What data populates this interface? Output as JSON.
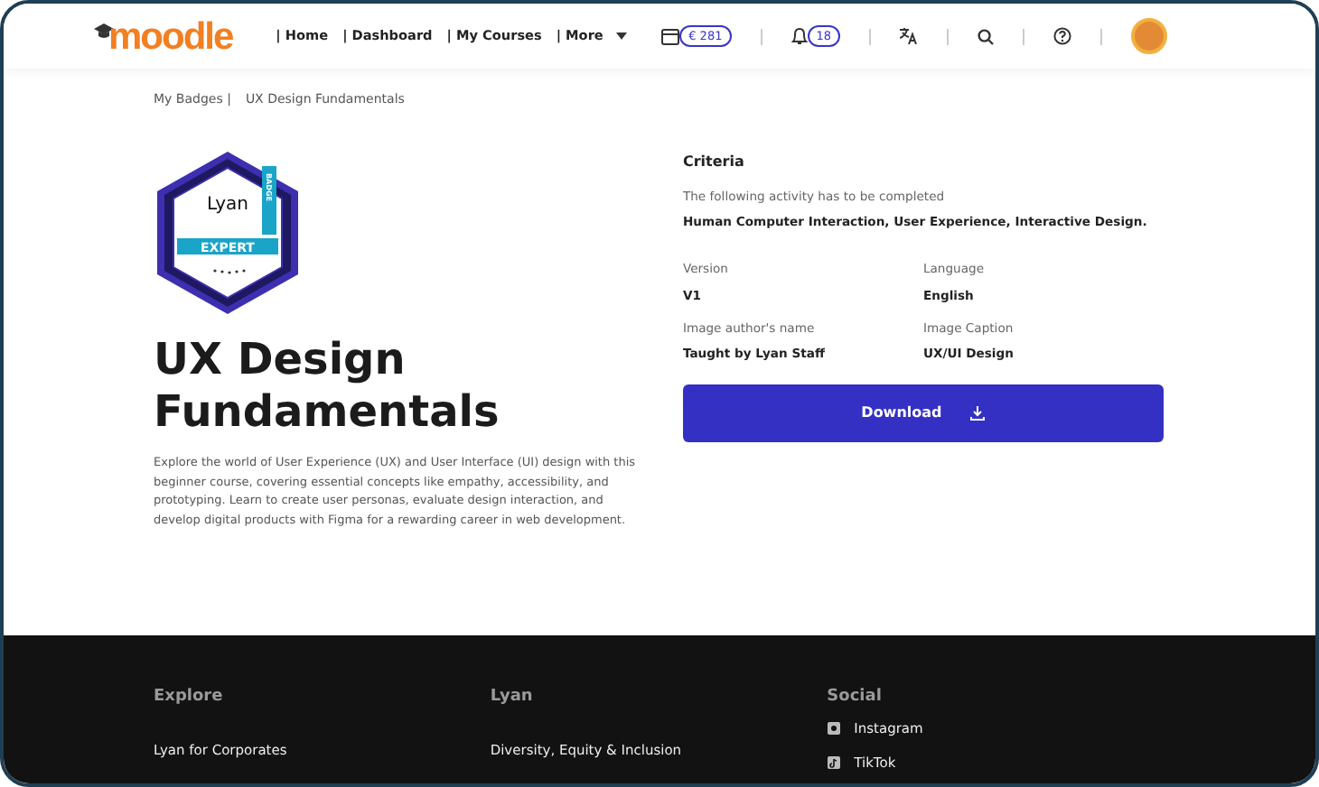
{
  "navbar": {
    "logo": "moodle",
    "links": [
      {
        "label": "| Home"
      },
      {
        "label": "| Dashboard"
      },
      {
        "label": "| My Courses"
      },
      {
        "label": "| More",
        "dropdown": true
      }
    ],
    "wallet": "€ 281",
    "notifications": "18"
  },
  "breadcrumb": [
    "My Badges |",
    "UX Design Fundamentals"
  ],
  "badge": {
    "brand": "Lyan",
    "ribbon": "BADGE",
    "level": "EXPERT"
  },
  "title": "UX Design Fundamentals",
  "description": "Explore the world of User Experience (UX) and User Interface (UI) design with this beginner course, covering essential concepts like empathy, accessibility, and prototyping. Learn to create user personas, evaluate design interaction, and develop digital products with Figma for a rewarding career in web development.",
  "criteria": {
    "heading": "Criteria",
    "intro": "The following activity has to be completed",
    "activities": "Human Computer Interaction, User Experience, Interactive Design."
  },
  "details": [
    {
      "label": "Version",
      "value": "V1"
    },
    {
      "label": "Language",
      "value": "English"
    },
    {
      "label": "Image author's name",
      "value": "Taught by Lyan Staff"
    },
    {
      "label": "Image Caption",
      "value": "UX/UI Design"
    }
  ],
  "download_button": "Download",
  "footer": [
    {
      "heading": "Explore",
      "links": [
        {
          "label": "Lyan for Corporates"
        }
      ]
    },
    {
      "heading": "Lyan",
      "links": [
        {
          "label": "Diversity, Equity & Inclusion"
        }
      ]
    },
    {
      "heading": "Social",
      "links": [
        {
          "label": "Instagram",
          "kind": "instagram"
        },
        {
          "label": "TikTok",
          "kind": "tiktok"
        }
      ]
    }
  ]
}
